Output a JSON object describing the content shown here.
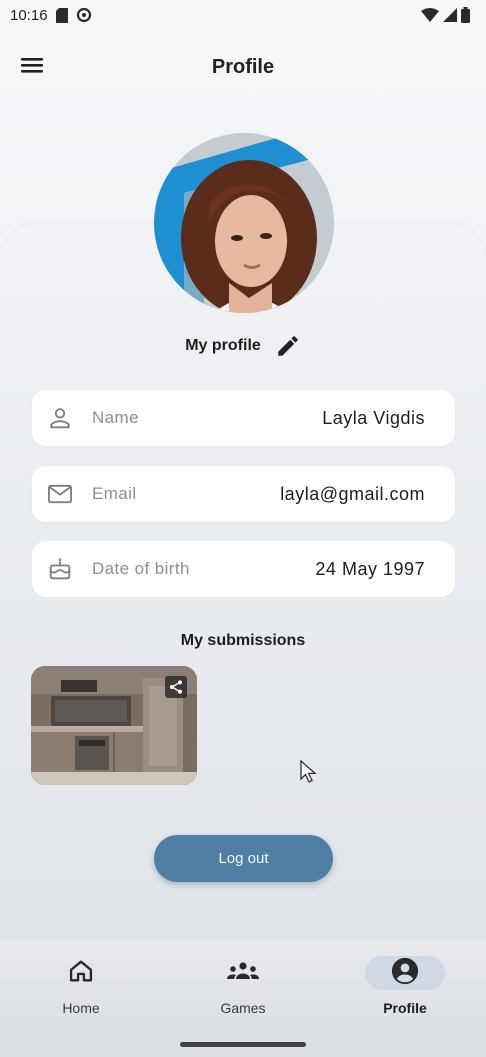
{
  "status_bar": {
    "time": "10:16",
    "icons": [
      "sim-card-icon",
      "settings-gear-icon",
      "wifi-icon",
      "signal-icon",
      "battery-icon"
    ]
  },
  "app_bar": {
    "title": "Profile",
    "menu_icon": "hamburger-menu-icon"
  },
  "profile": {
    "section_label": "My profile",
    "edit_icon": "pencil-icon",
    "fields": [
      {
        "icon": "person-icon",
        "label": "Name",
        "value": "Layla Vigdis"
      },
      {
        "icon": "mail-icon",
        "label": "Email",
        "value": "layla@gmail.com"
      },
      {
        "icon": "cake-icon",
        "label": "Date of birth",
        "value": "24 May 1997"
      }
    ]
  },
  "submissions": {
    "title": "My submissions",
    "share_icon": "share-icon"
  },
  "logout": {
    "label": "Log out"
  },
  "bottom_nav": {
    "items": [
      {
        "icon": "home-icon",
        "label": "Home"
      },
      {
        "icon": "group-icon",
        "label": "Games"
      },
      {
        "icon": "account-circle-icon",
        "label": "Profile"
      }
    ],
    "active": "Profile"
  },
  "colors": {
    "accent": "#4f7fa4",
    "background": "#eceef2",
    "field_bg": "#ffffff",
    "nav_active_pill": "#cfd8e3"
  }
}
